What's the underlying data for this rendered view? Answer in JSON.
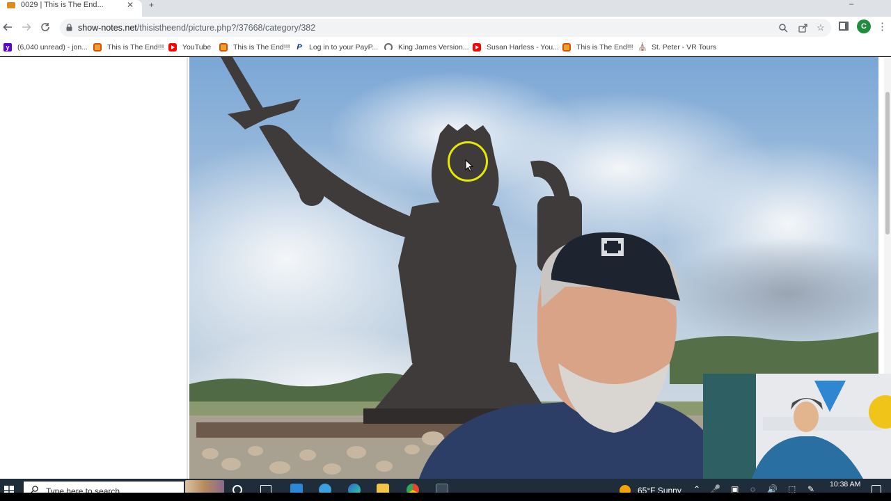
{
  "browser": {
    "tab": {
      "title": "0029 | This is The End..."
    },
    "url": {
      "domain": "show-notes.net",
      "path": "/thisistheend/picture.php?/37668/category/382"
    },
    "profile_initial": "C"
  },
  "bookmarks": [
    {
      "label": "(6,040 unread) - jon...",
      "icon": "yahoo-mail-icon"
    },
    {
      "label": "This is The End!!!",
      "icon": "end-site-icon"
    },
    {
      "label": "YouTube",
      "icon": "youtube-icon"
    },
    {
      "label": "This is The End!!!",
      "icon": "end-site-icon"
    },
    {
      "label": "Log in to your PayP...",
      "icon": "paypal-icon"
    },
    {
      "label": "King James Version...",
      "icon": "bible-site-icon"
    },
    {
      "label": "Susan Harless - You...",
      "icon": "youtube-icon"
    },
    {
      "label": "This is The End!!!",
      "icon": "end-site-icon"
    },
    {
      "label": "St. Peter - VR Tours",
      "icon": "vr-tours-icon"
    }
  ],
  "taskbar": {
    "search_placeholder": "Type here to search",
    "weather": "65°F  Sunny",
    "time": "10:38 AM"
  },
  "colors": {
    "accent_cursor": "#e8e800",
    "taskbar": "#1f2d3a",
    "avatar": "#1e8e3e"
  }
}
